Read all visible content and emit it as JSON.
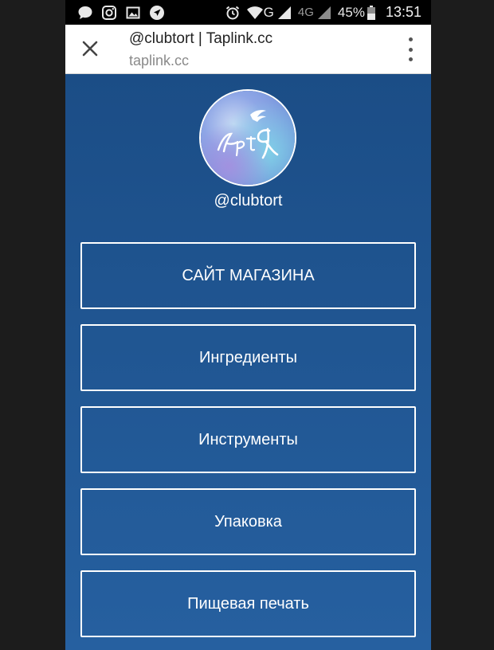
{
  "status_bar": {
    "battery_percent": "45%",
    "time": "13:51",
    "network_g": "G",
    "network_4g": "4G",
    "icons": [
      "chat-icon",
      "instagram-icon",
      "image-icon",
      "navigation-icon",
      "alarm-icon",
      "wifi-icon",
      "signal-icon",
      "battery-icon"
    ]
  },
  "browser": {
    "title": "@clubtort | Taplink.cc",
    "url": "taplink.cc"
  },
  "profile": {
    "username": "@clubtort",
    "avatar_text": "Арт Я"
  },
  "links": [
    {
      "label": "САЙТ МАГАЗИНА"
    },
    {
      "label": "Ингредиенты"
    },
    {
      "label": "Инструменты"
    },
    {
      "label": "Упаковка"
    },
    {
      "label": "Пищевая печать"
    }
  ],
  "colors": {
    "content_top": "#1b4d86",
    "content_bottom": "#2660a0",
    "button_border": "#ffffff"
  }
}
